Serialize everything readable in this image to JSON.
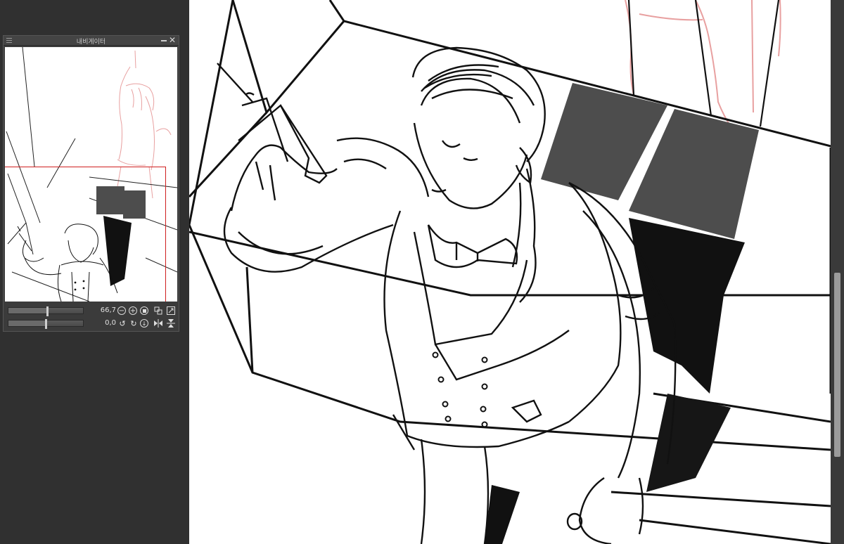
{
  "navigator": {
    "title": "내비게이터",
    "close_glyph": "✕",
    "zoom": {
      "value": "66,7",
      "level": 0.52
    },
    "rotation": {
      "value": "0,0",
      "level": 0.5
    },
    "icons": {
      "zoom_out": "zoom-out-icon",
      "zoom_in": "zoom-in-icon",
      "fit": "fit-page-icon",
      "actual_size": "actual-size-icon",
      "fit_window": "fit-window-icon",
      "rotate_left": "rotate-left-icon",
      "rotate_right": "rotate-right-icon",
      "reset_rotation": "reset-rotation-icon",
      "flip_h": "flip-horizontal-icon",
      "flip_v": "flip-vertical-icon"
    }
  },
  "canvas": {
    "subject": "line-art illustration"
  },
  "colors": {
    "workspace": "#2f2f2f",
    "panel": "#3b3b3b",
    "view_rect": "#d01e1e",
    "sketch": "#e8a0a0",
    "ink": "#111111",
    "tone": "#4d4d4d"
  }
}
